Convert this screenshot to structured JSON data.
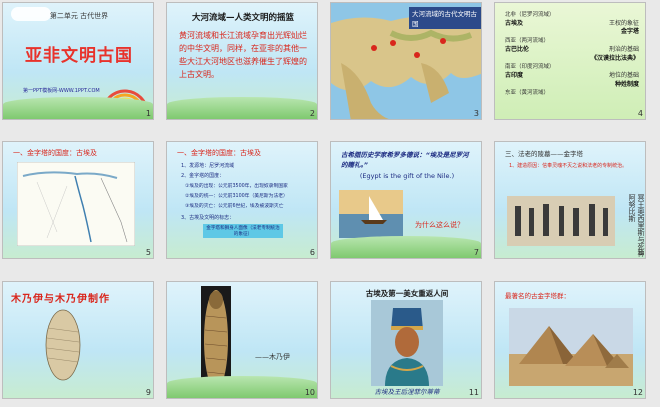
{
  "slides": [
    {
      "num": "1",
      "unit_title": "第二单元 古代世界",
      "title": "亚非文明古国",
      "footer": "第一PPT模板网-WWW.1PPT.COM"
    },
    {
      "num": "2",
      "heading": "大河流域—人类文明的摇篮",
      "body": "黄河流域和长江流域孕育出光辉灿烂的中华文明，同样，在亚非的其他一些大江大河地区也滋养催生了辉煌的上古文明。"
    },
    {
      "num": "3",
      "map_title": "大河流域的古代文明古国"
    },
    {
      "num": "4",
      "rows": [
        {
          "left": "北非（尼罗河流域）",
          "right": ""
        },
        {
          "left": "古埃及",
          "right": "王权的象征"
        },
        {
          "left": "",
          "right": "金字塔"
        },
        {
          "left": "西亚（两河流域）",
          "right": ""
        },
        {
          "left": "古巴比伦",
          "right": "刑治的基础"
        },
        {
          "left": "",
          "right": "《汉谟拉比法典》"
        },
        {
          "left": "南亚（印度河流域）",
          "right": ""
        },
        {
          "left": "古印度",
          "right": "地位的基础"
        },
        {
          "left": "",
          "right": "种姓制度"
        },
        {
          "left": "东亚（黄河流域）",
          "right": ""
        }
      ]
    },
    {
      "num": "5",
      "heading": "一、金字塔的国度：古埃及"
    },
    {
      "num": "6",
      "heading": "一、金字塔的国度：古埃及",
      "items": [
        "1、发源地：尼罗河流域",
        "2、金字塔的国度：",
        "①埃及的出现：公元前3500年，出现奴隶制国家",
        "②埃及的统一：公元前3100年（美尼斯为法老）",
        "③埃及的灭亡：公元前6世纪，埃及被波斯灭亡",
        "3、古埃及文明的标志：",
        "金字塔和狮身人面像（法老专制统治的象征）"
      ]
    },
    {
      "num": "7",
      "quote_line1": "古希腊历史学家希罗多德说：“埃及是尼罗河的赠礼。”",
      "quote_en": "(Egypt is the gift of the Nile.)",
      "question": "为什么这么说？"
    },
    {
      "num": "8",
      "heading": "三、法老的陵墓——金字塔",
      "body": "1、建造原因：信奉灵魂不灭之说和法老的专制统治。",
      "side": "冥王奥西里斯与死神阿努比斯"
    },
    {
      "num": "9",
      "heading": "木乃伊与木乃伊制作"
    },
    {
      "num": "10",
      "caption": "——木乃伊"
    },
    {
      "num": "11",
      "heading": "古埃及第一美女重返人间",
      "footer": "古埃及王后涅菲尔蒂蒂"
    },
    {
      "num": "12",
      "heading": "最著名的古金字塔群："
    }
  ],
  "colors": {
    "title_red": "#e8322b",
    "dark_blue": "#1d2c82",
    "body_red": "#d9261c"
  }
}
